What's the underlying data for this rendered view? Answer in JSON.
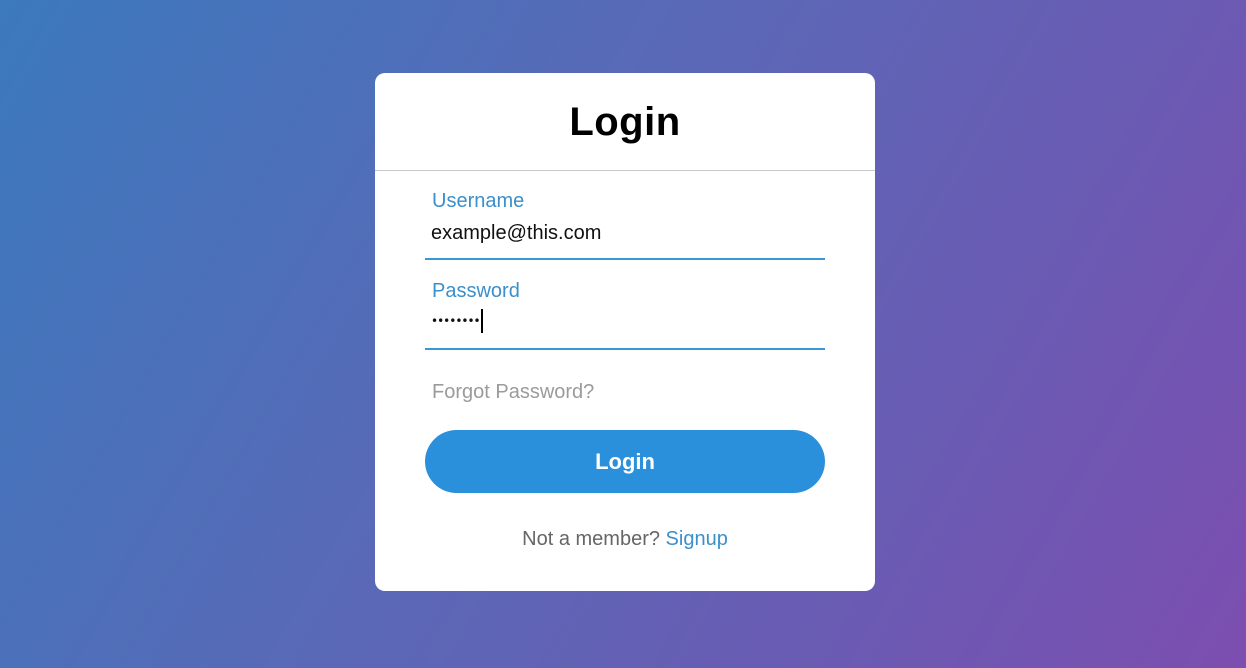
{
  "login_card": {
    "title": "Login",
    "username": {
      "label": "Username",
      "value": "example@this.com"
    },
    "password": {
      "label": "Password",
      "value": "••••••••"
    },
    "forgot_password": "Forgot Password?",
    "submit_label": "Login",
    "signup_prompt": "Not a member?",
    "signup_link": "Signup"
  },
  "colors": {
    "accent": "#3b8fca",
    "button": "#2a90db",
    "background_start": "#3c79bd",
    "background_end": "#7c4eb0"
  }
}
